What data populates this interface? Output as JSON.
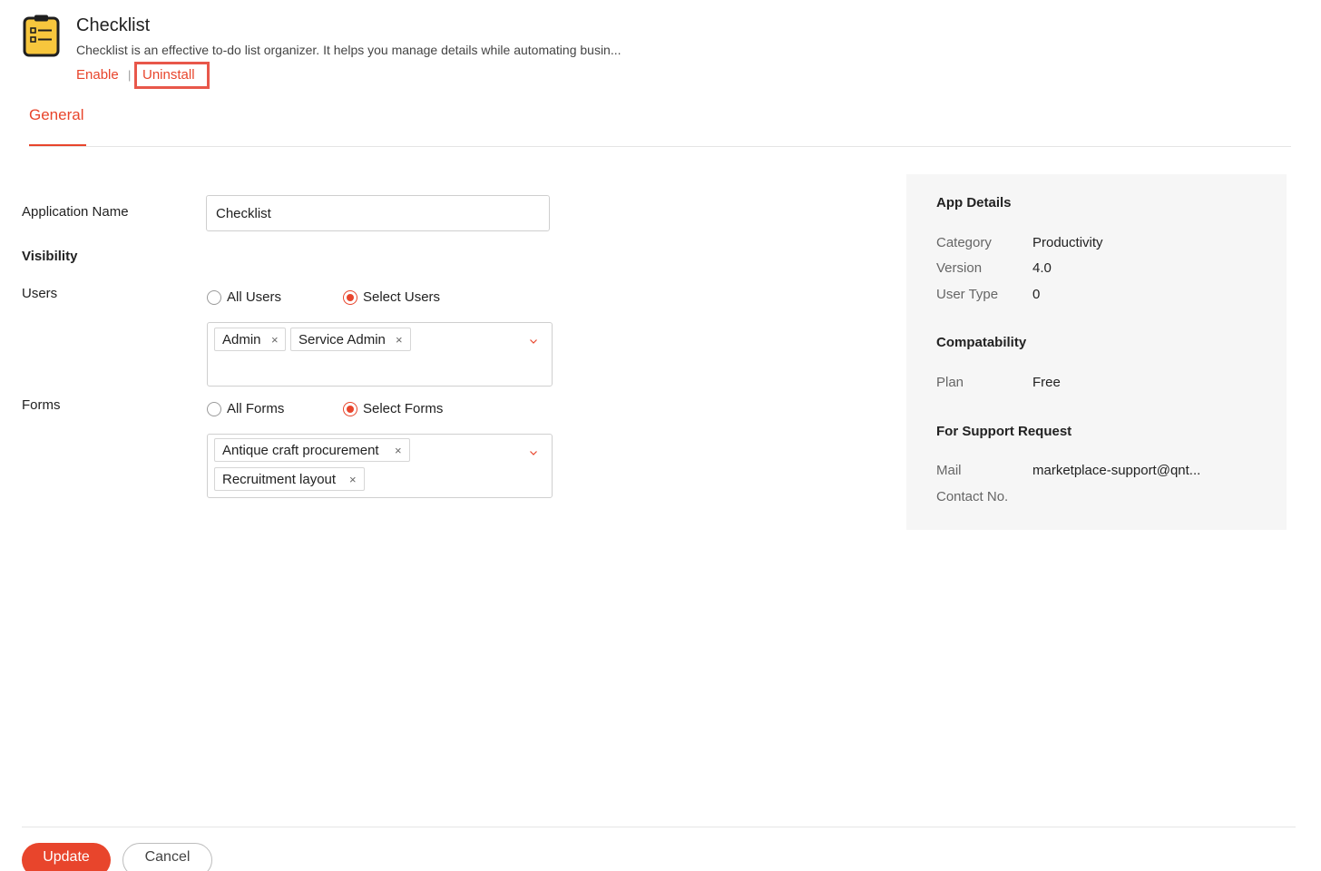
{
  "app": {
    "title": "Checklist",
    "description": "Checklist is an effective to-do list organizer. It helps you manage details while automating busin...",
    "enable_label": "Enable",
    "separator": "|",
    "uninstall_label": "Uninstall",
    "icon": "clipboard-checklist-icon"
  },
  "tabs": [
    {
      "label": "General",
      "active": true
    }
  ],
  "form": {
    "application_name_label": "Application Name",
    "application_name_value": "Checklist",
    "visibility_label": "Visibility",
    "users": {
      "label": "Users",
      "options": [
        {
          "label": "All Users",
          "checked": false
        },
        {
          "label": "Select Users",
          "checked": true
        }
      ],
      "selected": [
        {
          "label": "Admin",
          "remove": "×"
        },
        {
          "label": "Service Admin",
          "remove": "×"
        }
      ]
    },
    "forms": {
      "label": "Forms",
      "options": [
        {
          "label": "All Forms",
          "checked": false
        },
        {
          "label": "Select Forms",
          "checked": true
        }
      ],
      "selected": [
        {
          "label": "Antique craft procurement",
          "remove": "×"
        },
        {
          "label": "Recruitment layout",
          "remove": "×"
        }
      ]
    }
  },
  "details": {
    "app_details_heading": "App Details",
    "app_details": [
      {
        "key": "Category",
        "value": "Productivity"
      },
      {
        "key": "Version",
        "value": "4.0"
      },
      {
        "key": "User Type",
        "value": "0"
      }
    ],
    "compatibility_heading": "Compatability",
    "compatibility": [
      {
        "key": "Plan",
        "value": "Free"
      }
    ],
    "support_heading": "For Support Request",
    "support": [
      {
        "key": "Mail",
        "value": "marketplace-support@qnt..."
      },
      {
        "key": "Contact No.",
        "value": ""
      }
    ]
  },
  "footer": {
    "update_label": "Update",
    "cancel_label": "Cancel"
  },
  "colors": {
    "accent": "#e8452c",
    "icon_yellow": "#f7c63d",
    "panel_bg": "#f6f6f6"
  }
}
